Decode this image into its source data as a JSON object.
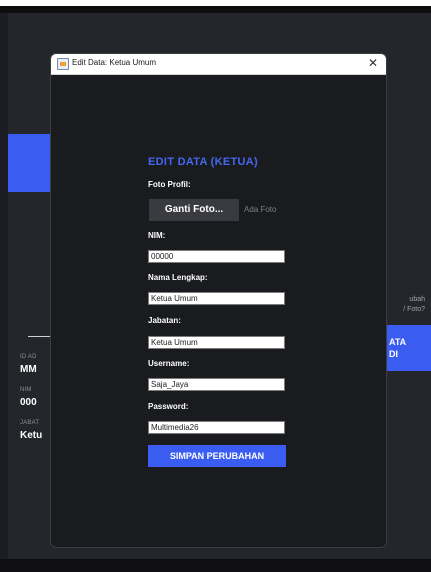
{
  "background": {
    "card": {
      "label_id": "ID AD",
      "value_id": "MM",
      "label_nim": "NIM",
      "value_nim": "000",
      "label_jabatan": "JABAT",
      "value_jabatan": "Ketu"
    },
    "side_text_1": "ubah",
    "side_text_2": "/ Foto?",
    "side_button_line1": "ATA",
    "side_button_line2": "DI"
  },
  "dialog": {
    "title": "Edit Data: Ketua Umum",
    "close_glyph": "✕",
    "heading": "EDIT DATA (KETUA)",
    "photo_label": "Foto Profil:",
    "photo_button": "Ganti Foto...",
    "photo_status": "Ada Foto",
    "nim_label": "NIM:",
    "nim_value": "00000",
    "name_label": "Nama Lengkap:",
    "name_value": "Ketua Umum",
    "position_label": "Jabatan:",
    "position_value": "Ketua Umum",
    "username_label": "Username:",
    "username_value": "Saja_Jaya",
    "password_label": "Password:",
    "password_value": "Multimedia26",
    "save_button": "SIMPAN PERUBAHAN"
  },
  "colors": {
    "accent": "#3a5cf0",
    "heading": "#4468f0",
    "dialog_bg": "#1a1b1f",
    "app_bg": "#24262b"
  }
}
